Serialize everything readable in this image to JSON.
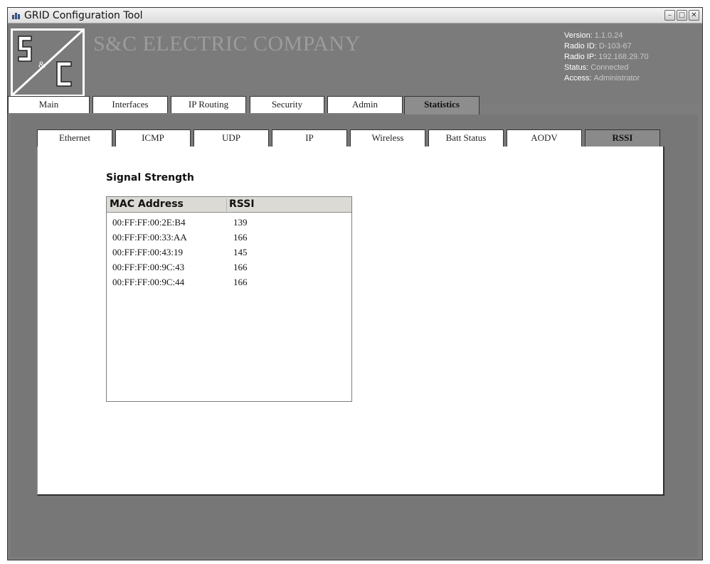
{
  "window": {
    "title": "GRID Configuration Tool",
    "controls": [
      "minimize",
      "maximize",
      "close"
    ]
  },
  "header": {
    "company": "S&C ELECTRIC COMPANY",
    "info": [
      {
        "label": "Version:",
        "value": "1.1.0.24"
      },
      {
        "label": "Radio ID:",
        "value": "D-103-67"
      },
      {
        "label": "Radio IP:",
        "value": "192.168.29.70"
      },
      {
        "label": "Status:",
        "value": "Connected"
      },
      {
        "label": "Access:",
        "value": "Administrator"
      }
    ]
  },
  "main_tabs": [
    {
      "label": "Main"
    },
    {
      "label": "Interfaces"
    },
    {
      "label": "IP Routing"
    },
    {
      "label": "Security"
    },
    {
      "label": "Admin"
    },
    {
      "label": "Statistics",
      "active": true
    }
  ],
  "sub_tabs": [
    {
      "label": "Ethernet"
    },
    {
      "label": "ICMP"
    },
    {
      "label": "UDP"
    },
    {
      "label": "IP"
    },
    {
      "label": "Wireless"
    },
    {
      "label": "Batt Status"
    },
    {
      "label": "AODV"
    },
    {
      "label": "RSSI",
      "active": true
    }
  ],
  "rssi": {
    "title": "Signal Strength",
    "columns": [
      "MAC Address",
      "RSSI"
    ],
    "rows": [
      {
        "mac": "00:FF:FF:00:2E:B4",
        "rssi": "139"
      },
      {
        "mac": "00:FF:FF:00:33:AA",
        "rssi": "166"
      },
      {
        "mac": "00:FF:FF:00:43:19",
        "rssi": "145"
      },
      {
        "mac": "00:FF:FF:00:9C:43",
        "rssi": "166"
      },
      {
        "mac": "00:FF:FF:00:9C:44",
        "rssi": "166"
      }
    ]
  },
  "colors": {
    "window_bg": "#7d7d7d",
    "panel_bg": "#ffffff",
    "active_tab": "#8a8a8a",
    "company_text": "#9c9c9c"
  }
}
